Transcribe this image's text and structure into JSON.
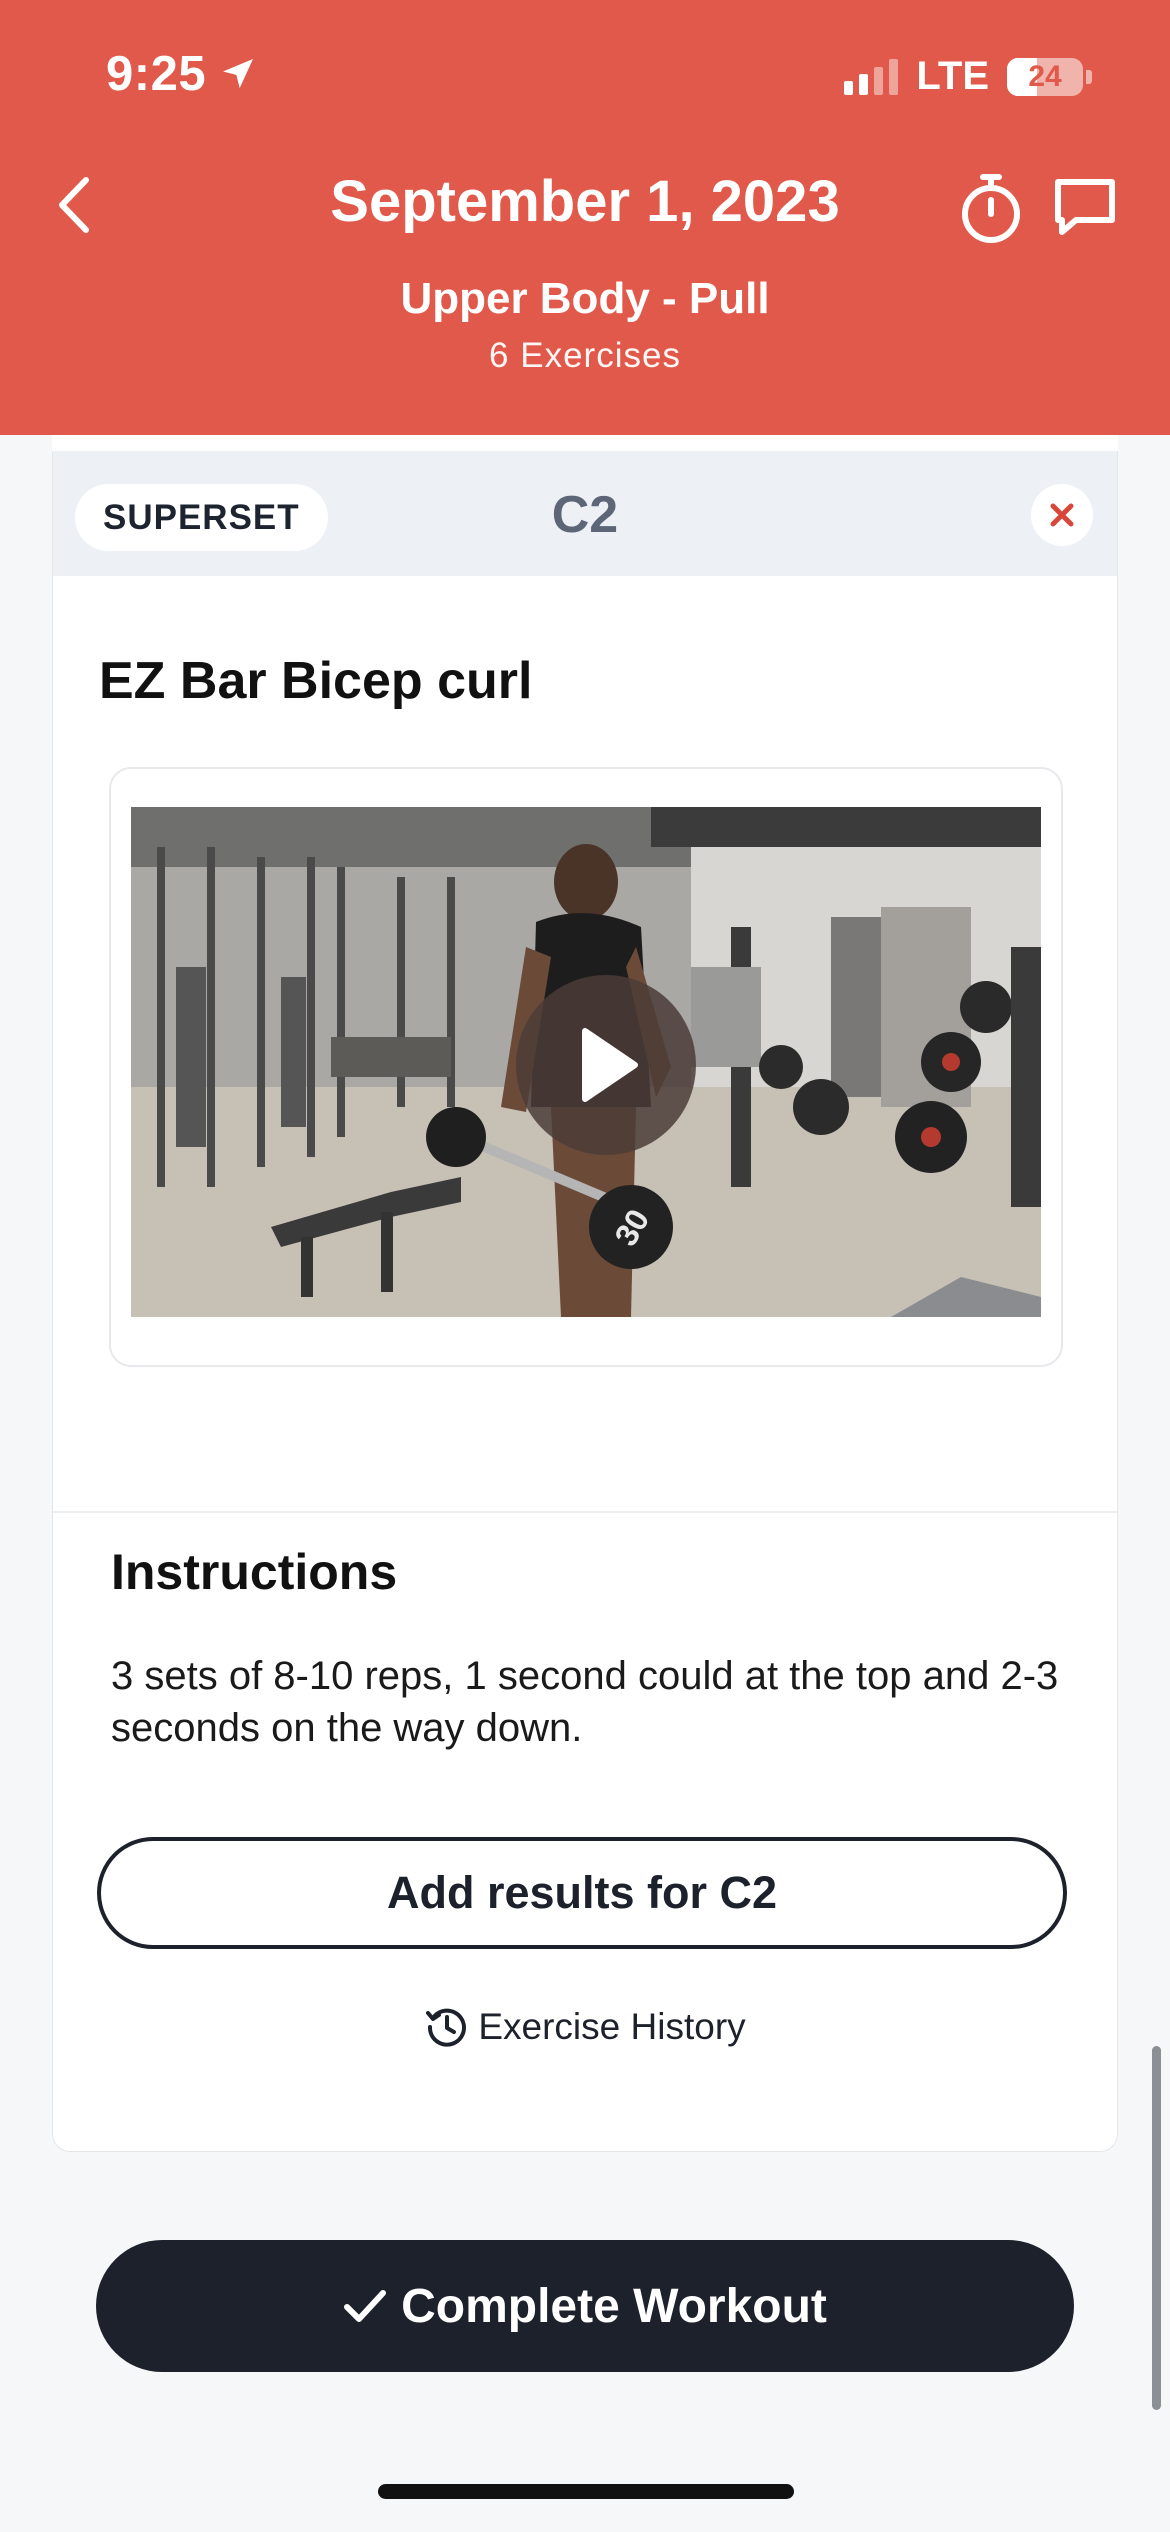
{
  "status_bar": {
    "time": "9:25",
    "network": "LTE",
    "battery": "24"
  },
  "header": {
    "title": "September 1, 2023",
    "subtitle": "Upper Body - Pull",
    "count": "6 Exercises",
    "background": "#e0594a",
    "icons": [
      "back-chevron-icon",
      "stopwatch-icon",
      "chat-bubble-icon"
    ]
  },
  "superset": {
    "badge": "SUPERSET",
    "group": "C2",
    "close_icon": "close-x-icon"
  },
  "exercise": {
    "name": "EZ Bar Bicep curl",
    "video": {
      "dumbbell_label": "30",
      "play_icon": "play-icon"
    }
  },
  "instructions": {
    "title": "Instructions",
    "text": "3 sets of 8-10 reps, 1 second could at the top and 2-3 seconds on the way down."
  },
  "actions": {
    "add_results": "Add results for C2",
    "history": "Exercise History",
    "complete": "Complete Workout"
  }
}
